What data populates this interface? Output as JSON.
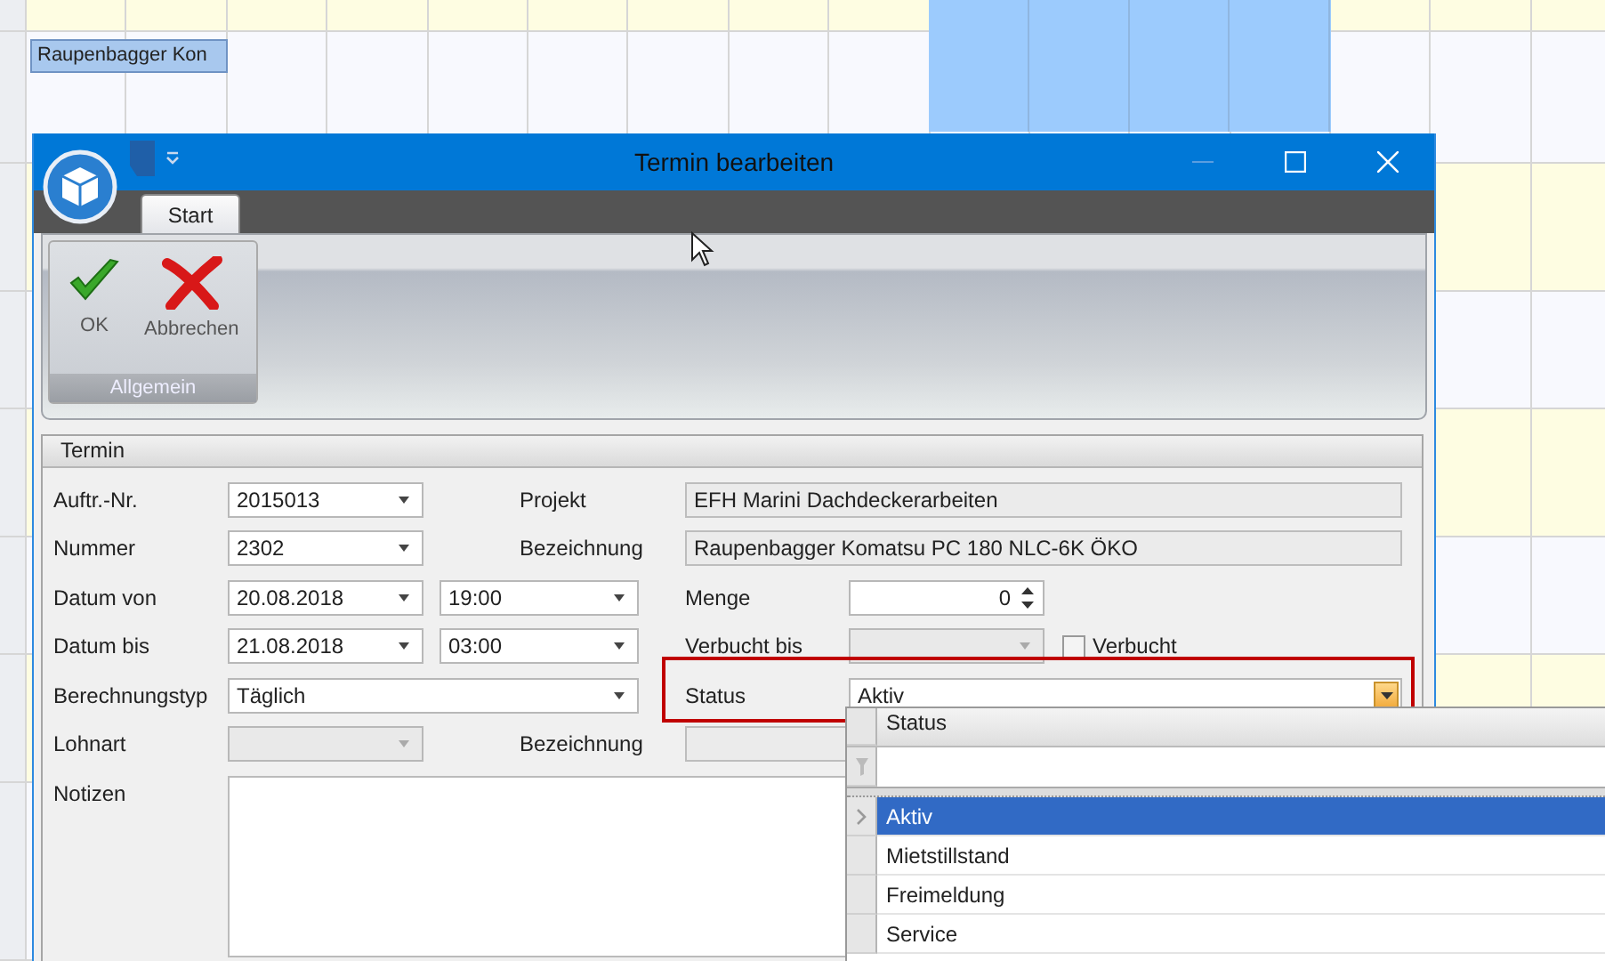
{
  "calendar": {
    "event": "Raupenbagger Kon"
  },
  "window": {
    "title": "Termin bearbeiten"
  },
  "ribbon": {
    "tabs": [
      {
        "label": "Start",
        "selected": true
      }
    ],
    "groups": [
      {
        "label": "Allgemein",
        "buttons": [
          {
            "kind": "ok",
            "label": "OK"
          },
          {
            "kind": "cancel",
            "label": "Abbrechen"
          }
        ]
      }
    ]
  },
  "form": {
    "title": "Termin",
    "order_number": {
      "label": "Auftr.-Nr.",
      "value": "2015013"
    },
    "project": {
      "label": "Projekt",
      "value": "EFH Marini Dachdeckerarbeiten"
    },
    "number": {
      "label": "Nummer",
      "value": "2302"
    },
    "description": {
      "label": "Bezeichnung",
      "value": "Raupenbagger Komatsu PC 180 NLC-6K ÖKO"
    },
    "date_from": {
      "label": "Datum von",
      "date": "20.08.2018",
      "time": "19:00"
    },
    "quantity": {
      "label": "Menge",
      "value": "0"
    },
    "date_to": {
      "label": "Datum bis",
      "date": "21.08.2018",
      "time": "03:00"
    },
    "booked_until": {
      "label": "Verbucht bis",
      "disabled": true
    },
    "booked": {
      "label": "Verbucht",
      "checked": false
    },
    "billing_type": {
      "label": "Berechnungstyp",
      "value": "Täglich"
    },
    "status": {
      "label": "Status",
      "value": "Aktiv",
      "highlighted": true
    },
    "wage_type": {
      "label": "Lohnart",
      "disabled": true
    },
    "wage_description": {
      "label": "Bezeichnung"
    },
    "notes": {
      "label": "Notizen"
    }
  },
  "status_dropdown": {
    "column": "Status",
    "items": [
      {
        "label": "Aktiv",
        "selected": true
      },
      {
        "label": "Mietstillstand",
        "selected": false
      },
      {
        "label": "Freimeldung",
        "selected": false
      },
      {
        "label": "Service",
        "selected": false
      }
    ]
  }
}
